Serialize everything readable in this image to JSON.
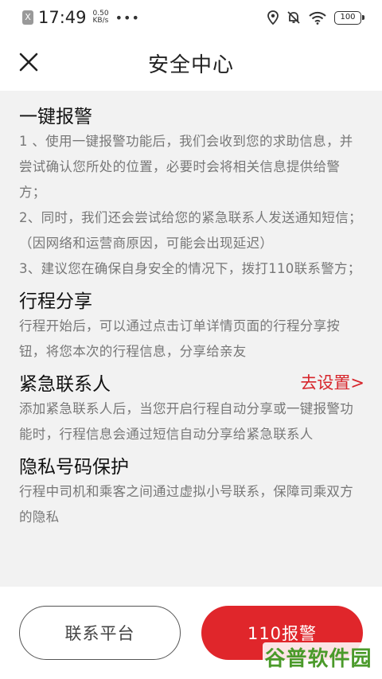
{
  "status_bar": {
    "sim": "X",
    "time": "17:49",
    "net_speed_value": "0.50",
    "net_speed_unit": "KB/s",
    "dots": "•••",
    "battery": "100"
  },
  "nav": {
    "title": "安全中心"
  },
  "sections": [
    {
      "title": "一键报警",
      "paragraphs": [
        "1 、使用一键报警功能后，我们会收到您的求助信息，并尝试确认您所处的位置，必要时会将相关信息提供给警方；",
        " 2、同时，我们还会尝试给您的紧急联系人发送通知短信；（因网络和运营商原因，可能会出现延迟）",
        " 3、建议您在确保自身安全的情况下，拨打110联系警方；"
      ]
    },
    {
      "title": "行程分享",
      "paragraphs": [
        "行程开始后，可以通过点击订单详情页面的行程分享按钮，将您本次的行程信息，分享给亲友"
      ]
    },
    {
      "title": "紧急联系人",
      "link": "去设置>",
      "paragraphs": [
        "添加紧急联系人后，当您开启行程自动分享或一键报警功能时，行程信息会通过短信自动分享给紧急联系人"
      ]
    },
    {
      "title": "隐私号码保护",
      "paragraphs": [
        "行程中司机和乘客之间通过虚拟小号联系，保障司乘双方的隐私"
      ]
    }
  ],
  "buttons": {
    "contact_platform": "联系平台",
    "call_110": "110报警"
  },
  "watermark": "谷普软件园",
  "colors": {
    "accent": "#e0262b",
    "content_bg": "#f2f2f2",
    "body_text": "#777777"
  },
  "icons": {
    "close": "close-icon",
    "location": "location-icon",
    "mute": "bell-off-icon",
    "wifi": "wifi-icon"
  }
}
